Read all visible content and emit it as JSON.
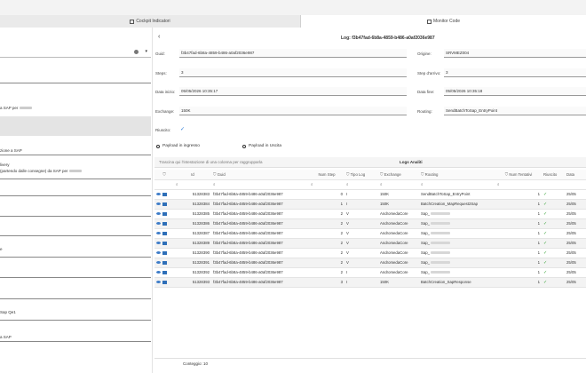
{
  "tabs": [
    {
      "label": "Cockpit Indicatori"
    },
    {
      "label": "Monitor Code"
    }
  ],
  "left": {
    "texts": [
      "a SAP per",
      "zione a SAP",
      "livery",
      "(partendo dalle consegne) da SAP per",
      "Sap Qe1",
      "a SAP"
    ]
  },
  "log": {
    "title": "Log: f3b47fad-6b8a-4859-b486-a0af2036e987",
    "fields": {
      "guid_label": "Guid:",
      "guid_value": "f3b47fad-6b8a-4859-b486-a0af2036e987",
      "origine_label": "Origine:",
      "origine_value": "SRVMEZ004",
      "steps_label": "Steps:",
      "steps_value": "3",
      "step_arrivo_label": "Step d'arrivo:",
      "step_arrivo_value": "3",
      "data_inizio_label": "Data inizio:",
      "data_inizio_value": "05/05/2026 10:35:17",
      "data_fine_label": "Data fine:",
      "data_fine_value": "05/05/2026 10:35:18",
      "exchange_label": "Exchange:",
      "exchange_value": "150K",
      "routing_label": "Routing:",
      "routing_value": "SendBatchToSap_EntryPoint",
      "riuscito_label": "Riuscito:"
    },
    "payload_in": "Payload in ingresso",
    "payload_out": "Payload in Uscita",
    "drag_hint": "Trascina qui l'intestazione di una colonna per raggrupparla",
    "table_title": "Logs Analiti",
    "columns": [
      "Id",
      "Guid",
      "Num Step",
      "Tipo Log",
      "Exchange",
      "Routing",
      "Num Tentativi",
      "Riuscito",
      "Data"
    ],
    "rows": [
      {
        "id": "51328383",
        "guid": "f3b47fad-6b8a-4859-b486-a0af2036e987",
        "step": "0",
        "tipo": "I",
        "exchange": "150K",
        "routing": "SendBatchToSap_EntryPoint",
        "tentativi": "1",
        "data": "25/05"
      },
      {
        "id": "51328384",
        "guid": "f3b47fad-6b8a-4859-b486-a0af2036e987",
        "step": "1",
        "tipo": "I",
        "exchange": "150K",
        "routing": "BatchCreation_MapRequest2Sap",
        "tentativi": "1",
        "data": "25/05"
      },
      {
        "id": "51328385",
        "guid": "f3b47fad-6b8a-4859-b486-a0af2036e987",
        "step": "2",
        "tipo": "V",
        "exchange": "AndromedaCore",
        "routing": "Sap_",
        "tentativi": "1",
        "data": "25/05"
      },
      {
        "id": "51328386",
        "guid": "f3b47fad-6b8a-4859-b486-a0af2036e987",
        "step": "2",
        "tipo": "V",
        "exchange": "AndromedaCore",
        "routing": "Sap_",
        "tentativi": "1",
        "data": "25/05"
      },
      {
        "id": "51328387",
        "guid": "f3b47fad-6b8a-4859-b486-a0af2036e987",
        "step": "2",
        "tipo": "V",
        "exchange": "AndromedaCore",
        "routing": "Sap_",
        "tentativi": "1",
        "data": "25/05"
      },
      {
        "id": "51328389",
        "guid": "f3b47fad-6b8a-4859-b486-a0af2036e987",
        "step": "2",
        "tipo": "V",
        "exchange": "AndromedaCore",
        "routing": "Sap_",
        "tentativi": "1",
        "data": "25/05"
      },
      {
        "id": "51328390",
        "guid": "f3b47fad-6b8a-4859-b486-a0af2036e987",
        "step": "2",
        "tipo": "V",
        "exchange": "AndromedaCore",
        "routing": "Sap_",
        "tentativi": "1",
        "data": "25/05"
      },
      {
        "id": "51328391",
        "guid": "f3b47fad-6b8a-4859-b486-a0af2036e987",
        "step": "2",
        "tipo": "V",
        "exchange": "AndromedaCore",
        "routing": "Sap_",
        "tentativi": "1",
        "data": "25/05"
      },
      {
        "id": "51328392",
        "guid": "f3b47fad-6b8a-4859-b486-a0af2036e987",
        "step": "2",
        "tipo": "I",
        "exchange": "AndromedaCore",
        "routing": "Sap_",
        "tentativi": "1",
        "data": "25/05"
      },
      {
        "id": "51328393",
        "guid": "f3b47fad-6b8a-4859-b486-a0af2036e987",
        "step": "3",
        "tipo": "I",
        "exchange": "150K",
        "routing": "BatchCreation_SapResponse",
        "tentativi": "1",
        "data": "25/05"
      }
    ],
    "footer_count": "Conteggio: 10"
  },
  "colors": {
    "accent": "#2b7bd6",
    "success": "#3aa53a"
  }
}
